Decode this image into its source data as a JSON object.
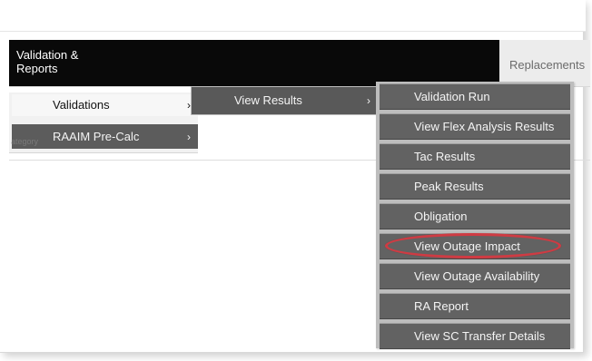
{
  "menubar": {
    "left_menu_label": "Validation &\nReports",
    "right_menu_label": "Replacements"
  },
  "left_menu": {
    "items": [
      {
        "label": "Validations",
        "chevron": "›"
      },
      {
        "label": "RAAIM Pre-Calc",
        "chevron": "›"
      }
    ],
    "faint_text": "ategory"
  },
  "middle_menu": {
    "label": "View Results",
    "chevron": "›"
  },
  "submenu": {
    "items": [
      "Validation Run",
      "View Flex Analysis Results",
      "Tac Results",
      "Peak Results",
      "Obligation",
      "View Outage Impact",
      "View Outage Availability",
      "RA Report",
      "View SC Transfer Details"
    ]
  },
  "highlight": {
    "color": "#cf3b43",
    "target_label": "View Outage Impact"
  },
  "icons": {
    "chevron": "chevron-right-icon"
  }
}
